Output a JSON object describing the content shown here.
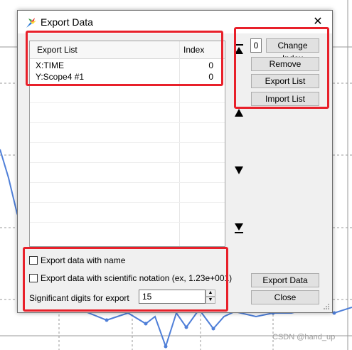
{
  "dialog": {
    "title": "Export Data",
    "close_glyph": "✕"
  },
  "list": {
    "columns": [
      "Export List",
      "Index"
    ],
    "rows": [
      {
        "name": "X:TIME",
        "index": "0"
      },
      {
        "name": "Y:Scope4 #1",
        "index": "0"
      }
    ]
  },
  "index_field": {
    "value": "0"
  },
  "buttons": {
    "change_index": "Change Index",
    "remove": "Remove",
    "export_list": "Export List",
    "import_list": "Import List",
    "export_data": "Export Data",
    "close": "Close"
  },
  "options": {
    "export_with_name": "Export data with name",
    "export_scientific": "Export data with scientific notation (ex, 1.23e+001)",
    "sig_digits_label": "Significant digits for export",
    "sig_digits_value": "15"
  },
  "icons": [
    "export-app-icon",
    "move-top-icon",
    "move-up-icon",
    "move-down-icon",
    "move-bottom-icon",
    "close-icon",
    "spin-up-icon",
    "spin-down-icon",
    "resize-grip-icon"
  ],
  "colors": {
    "highlight_box": "#e8202a",
    "plot_line": "#4f7fd8"
  },
  "watermark": "CSDN @hand_up"
}
